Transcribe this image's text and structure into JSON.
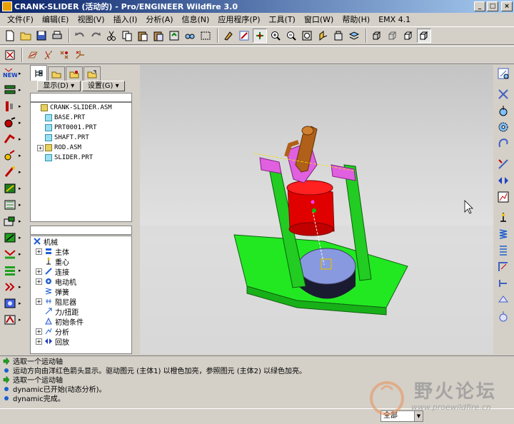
{
  "window": {
    "title": "CRANK-SLIDER (活动的) - Pro/ENGINEER Wildfire 3.0",
    "minimize": "_",
    "maximize": "□",
    "close": "×"
  },
  "menu": [
    "文件(F)",
    "编辑(E)",
    "视图(V)",
    "插入(I)",
    "分析(A)",
    "信息(N)",
    "应用程序(P)",
    "工具(T)",
    "窗口(W)",
    "帮助(H)",
    "EMX 4.1"
  ],
  "navigator": {
    "show_label": "显示(D) ▾",
    "settings_label": "设置(G) ▾",
    "model_tree": [
      {
        "label": "CRANK-SLIDER.ASM",
        "type": "asm",
        "indent": 0,
        "expand": ""
      },
      {
        "label": "BASE.PRT",
        "type": "prt",
        "indent": 1,
        "expand": ""
      },
      {
        "label": "PRT0001.PRT",
        "type": "prt",
        "indent": 1,
        "expand": ""
      },
      {
        "label": "SHAFT.PRT",
        "type": "prt",
        "indent": 1,
        "expand": ""
      },
      {
        "label": "ROD.ASM",
        "type": "asm",
        "indent": 1,
        "expand": "+"
      },
      {
        "label": "SLIDER.PRT",
        "type": "prt",
        "indent": 1,
        "expand": ""
      }
    ],
    "mechanism_tree": [
      {
        "label": "机械",
        "indent": 0,
        "expand": "",
        "icon": "mechanism-icon"
      },
      {
        "label": "主体",
        "indent": 1,
        "expand": "+",
        "icon": "body-icon"
      },
      {
        "label": "重心",
        "indent": 1,
        "expand": "",
        "icon": "gravity-icon"
      },
      {
        "label": "连接",
        "indent": 1,
        "expand": "+",
        "icon": "connection-icon"
      },
      {
        "label": "电动机",
        "indent": 1,
        "expand": "+",
        "icon": "motor-icon"
      },
      {
        "label": "弹簧",
        "indent": 1,
        "expand": "",
        "icon": "spring-icon"
      },
      {
        "label": "阻尼器",
        "indent": 1,
        "expand": "+",
        "icon": "damper-icon"
      },
      {
        "label": "力/扭距",
        "indent": 1,
        "expand": "",
        "icon": "force-icon"
      },
      {
        "label": "初始条件",
        "indent": 1,
        "expand": "",
        "icon": "initial-condition-icon"
      },
      {
        "label": "分析",
        "indent": 1,
        "expand": "+",
        "icon": "analysis-icon"
      },
      {
        "label": "回放",
        "indent": 1,
        "expand": "+",
        "icon": "playback-icon"
      }
    ]
  },
  "messages": [
    {
      "kind": "prompt",
      "text": "选取一个运动轴"
    },
    {
      "kind": "info",
      "text": "运动方向由洋红色箭头显示。驱动图元 (主体1) 以橙色加亮，参照图元 (主体2) 以绿色加亮。"
    },
    {
      "kind": "prompt",
      "text": "选取一个运动轴"
    },
    {
      "kind": "info",
      "text": "dynamic已开始(动态分析)。"
    },
    {
      "kind": "info",
      "text": "dynamic完成。"
    }
  ],
  "status": {
    "filter": "全部"
  },
  "watermark": {
    "text": "野火论坛",
    "url": "www.proewildfire.cn"
  },
  "colors": {
    "base": "#22e822",
    "frame": "#22cc22",
    "cylinder": "#e00000",
    "disk_top": "#8899e0",
    "disk_side": "#202040",
    "pins": "#e060e0",
    "crank": "#b06018"
  }
}
